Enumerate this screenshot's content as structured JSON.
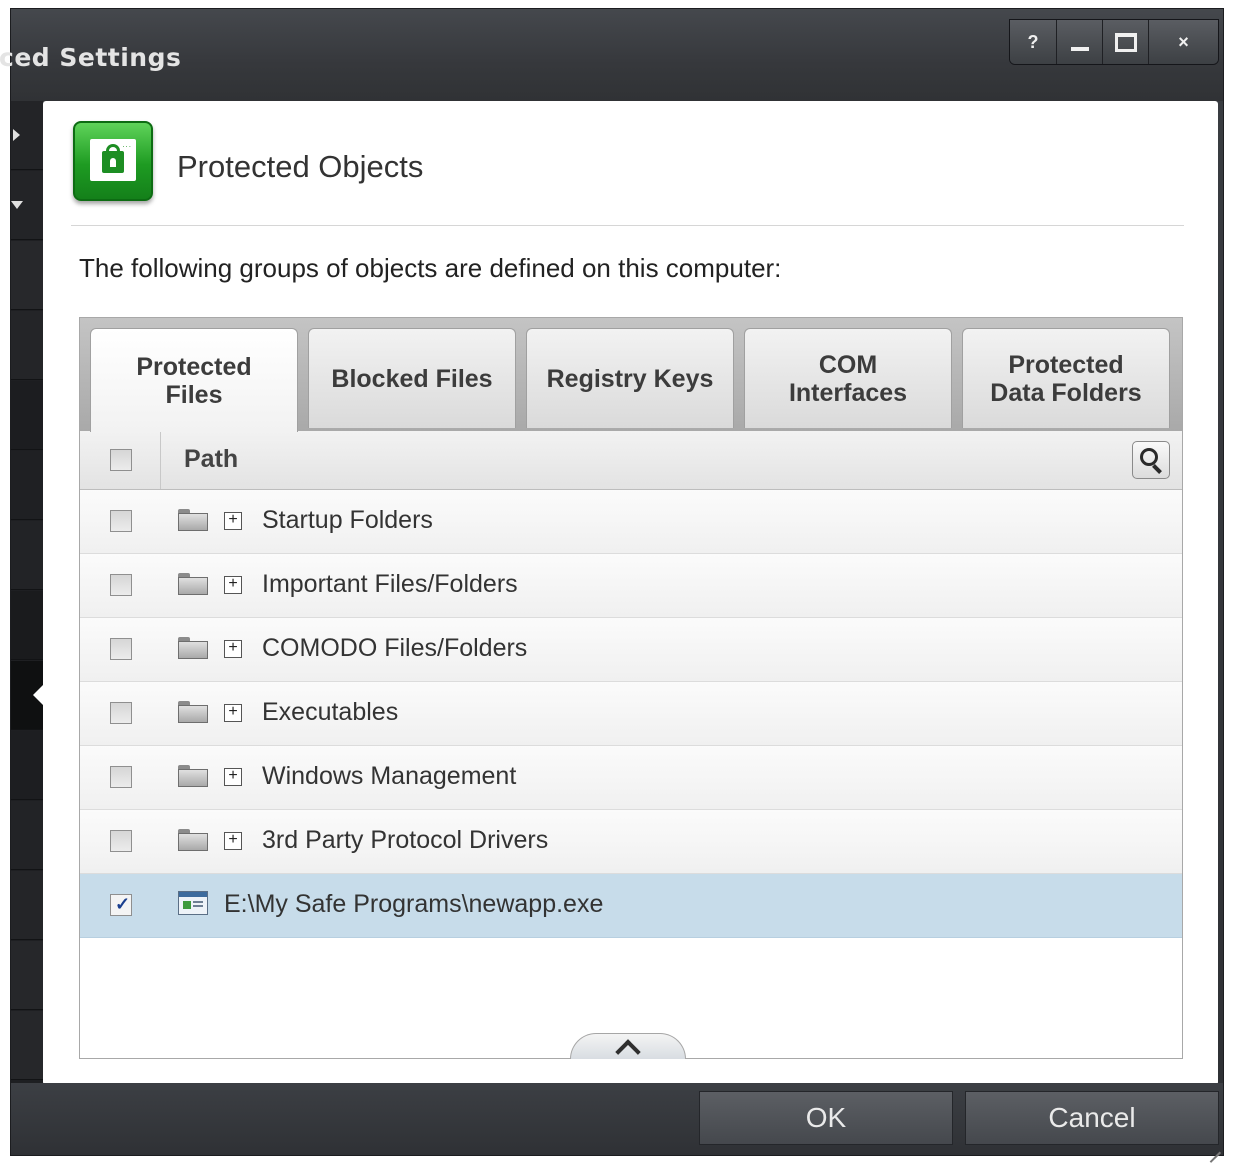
{
  "window": {
    "title": "ced Settings",
    "buttons": {
      "help": "?",
      "close": "×"
    }
  },
  "panel": {
    "heading": "Protected Objects",
    "intro": "The following groups of objects are defined on this computer:"
  },
  "tabs": [
    {
      "line1": "Protected",
      "line2": "Files",
      "active": true
    },
    {
      "line1": "Blocked Files",
      "line2": "",
      "active": false
    },
    {
      "line1": "Registry Keys",
      "line2": "",
      "active": false
    },
    {
      "line1": "COM",
      "line2": "Interfaces",
      "active": false
    },
    {
      "line1": "Protected",
      "line2": "Data Folders",
      "active": false
    }
  ],
  "table": {
    "header": {
      "path": "Path"
    },
    "rows": [
      {
        "label": "Startup Folders",
        "type": "group",
        "checked": false
      },
      {
        "label": "Important Files/Folders",
        "type": "group",
        "checked": false
      },
      {
        "label": "COMODO Files/Folders",
        "type": "group",
        "checked": false
      },
      {
        "label": "Executables",
        "type": "group",
        "checked": false
      },
      {
        "label": "Windows Management",
        "type": "group",
        "checked": false
      },
      {
        "label": "3rd Party Protocol Drivers",
        "type": "group",
        "checked": false
      },
      {
        "label": "E:\\My Safe Programs\\newapp.exe",
        "type": "file",
        "checked": true
      }
    ]
  },
  "footer": {
    "ok": "OK",
    "cancel": "Cancel"
  },
  "colors": {
    "accent_green": "#1e9b22",
    "selected_row": "#c7dcea",
    "chrome_dark": "#36383c"
  }
}
